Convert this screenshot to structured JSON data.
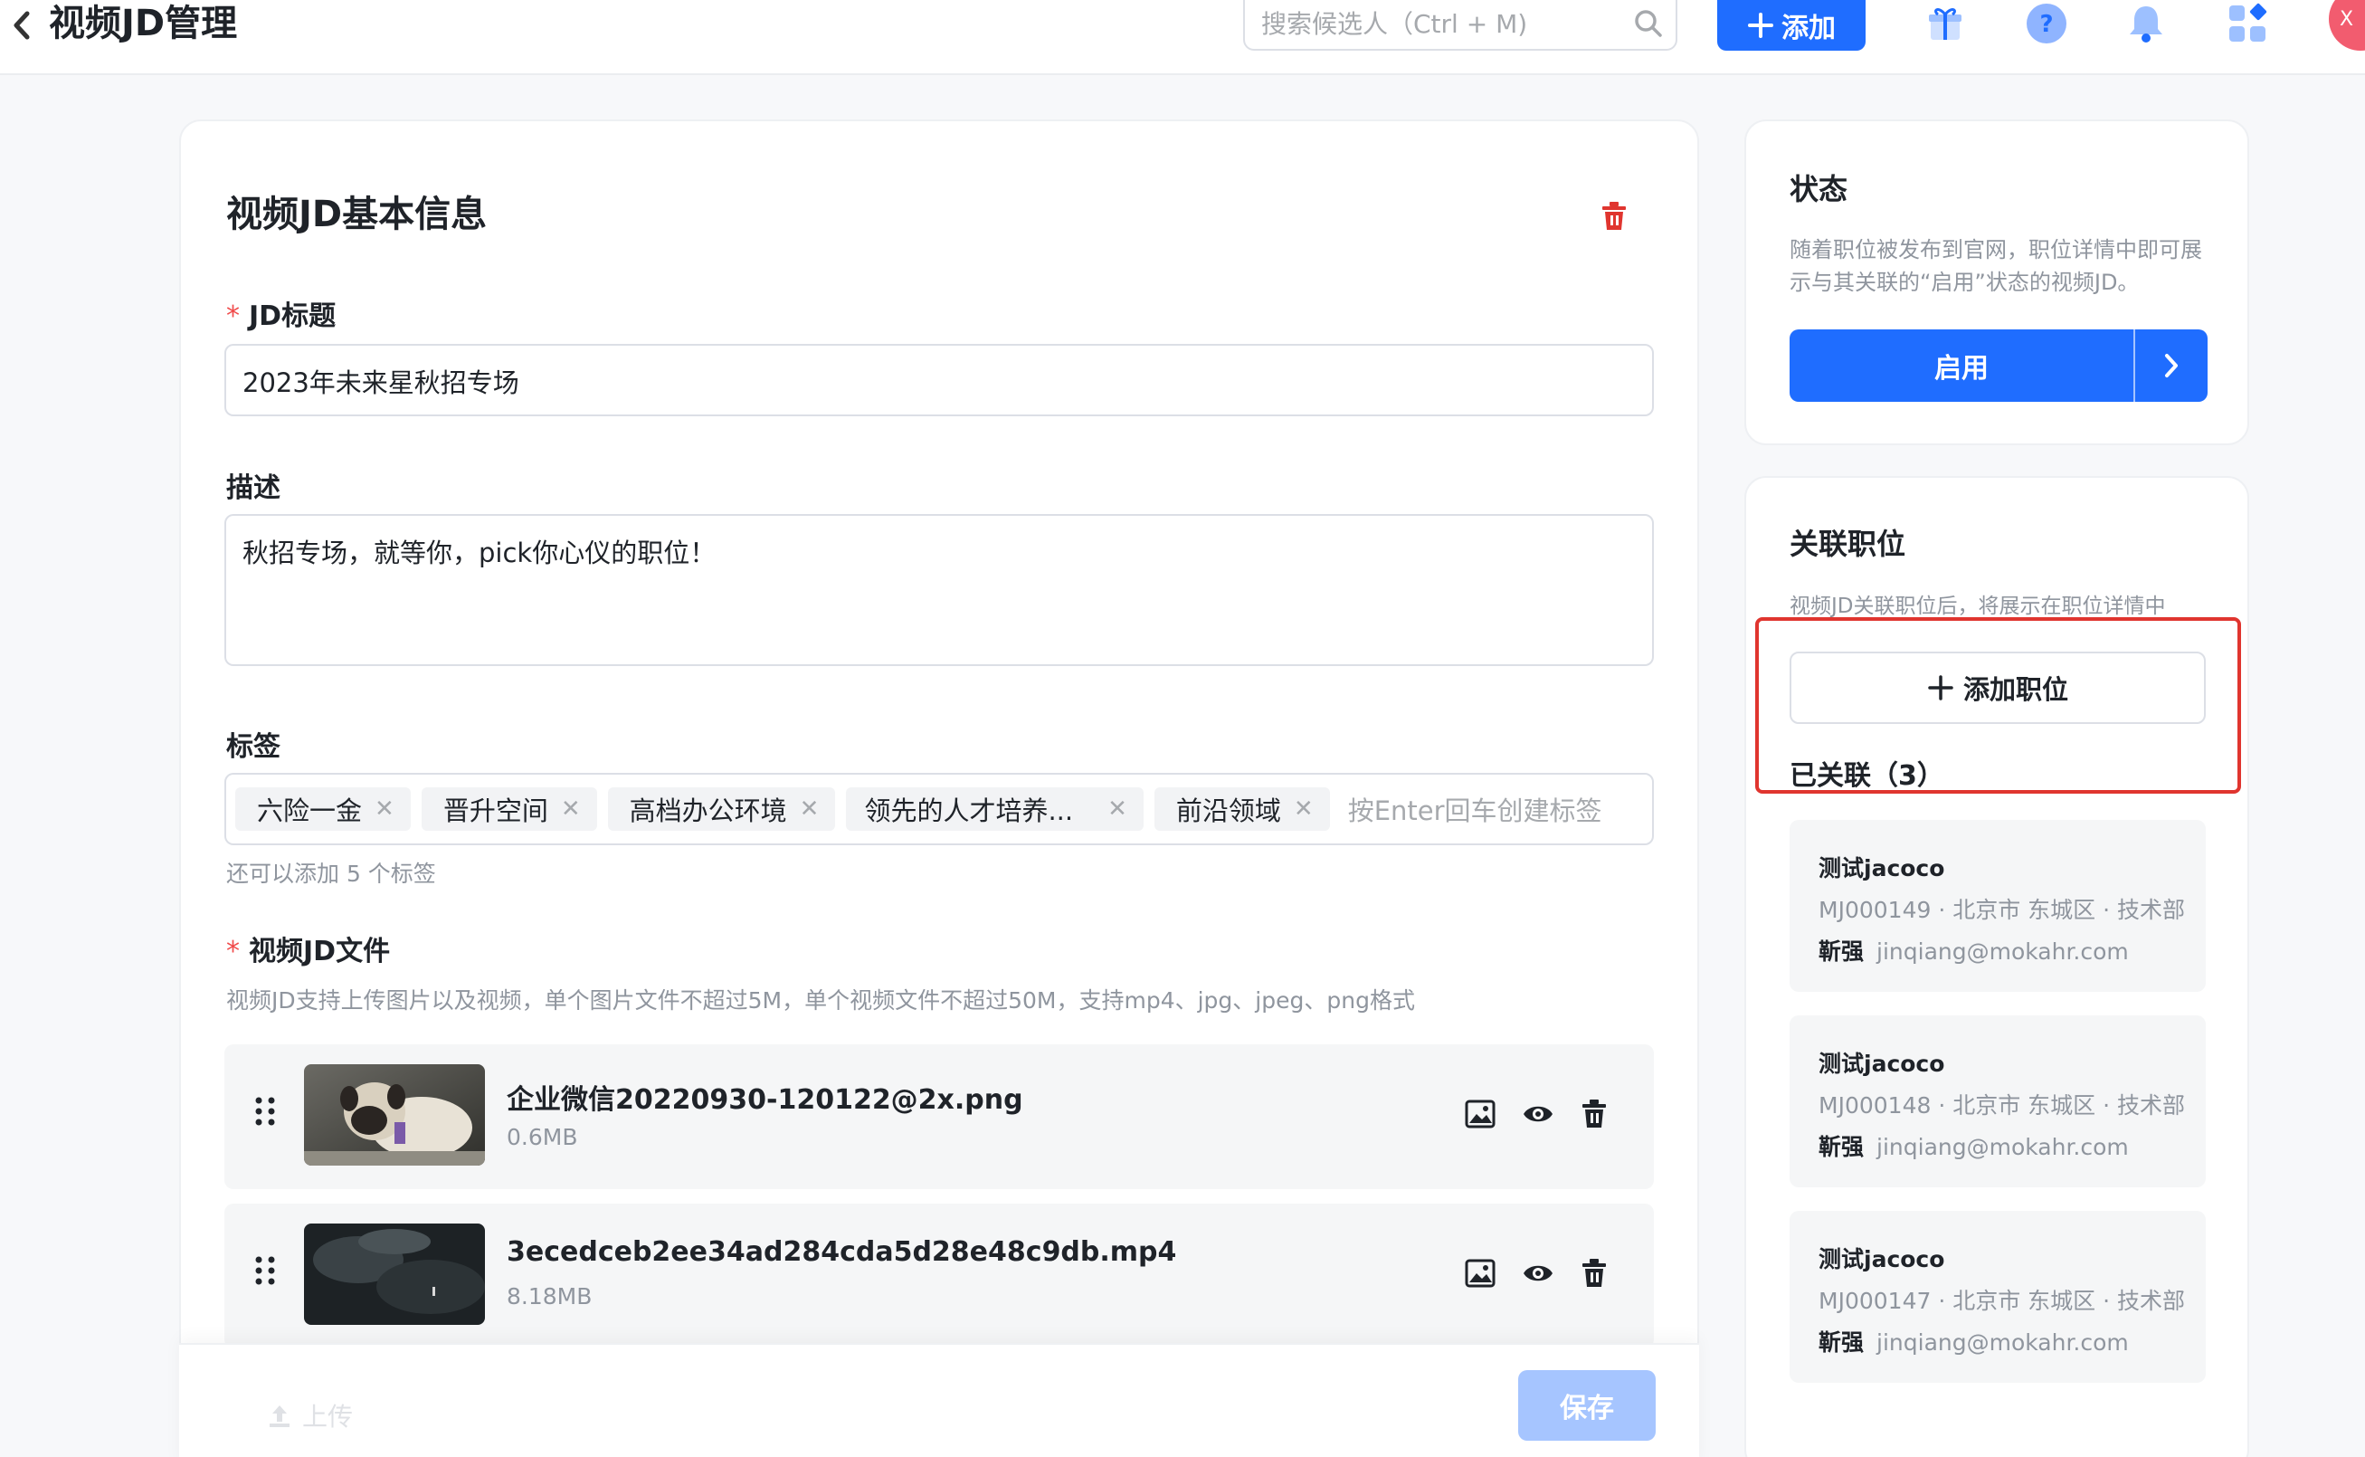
{
  "header": {
    "title": "视频JD管理",
    "search_placeholder": "搜索候选人（Ctrl + M)",
    "add_label": "添加",
    "avatar_text": "X"
  },
  "basic": {
    "title": "视频JD基本信息",
    "jd_title_label": "JD标题",
    "jd_title_value": "2023年未来星秋招专场",
    "desc_label": "描述",
    "desc_value": "秋招专场，就等你，pick你心仪的职位！",
    "tags_label": "标签",
    "tags": [
      "六险一金",
      "晋升空间",
      "高档办公环境",
      "领先的人才培养...",
      "前沿领域"
    ],
    "tag_placeholder": "按Enter回车创建标签",
    "tag_hint": "还可以添加 5 个标签",
    "files_label": "视频JD文件",
    "files_hint": "视频JD支持上传图片以及视频，单个图片文件不超过5M，单个视频文件不超过50M，支持mp4、jpg、jpeg、png格式",
    "files": [
      {
        "name": "企业微信20220930-120122@2x.png",
        "size": "0.6MB"
      },
      {
        "name": "3ecedceb2ee34ad284cda5d28e48c9db.mp4",
        "size": "8.18MB"
      }
    ]
  },
  "footer": {
    "upload_label": "上传",
    "save_label": "保存"
  },
  "status": {
    "title": "状态",
    "desc": "随着职位被发布到官网，职位详情中即可展示与其关联的“启用”状态的视频JD。",
    "button_label": "启用"
  },
  "linked": {
    "title": "关联职位",
    "desc": "视频JD关联职位后，将展示在职位详情中",
    "add_label": "添加职位",
    "count_label": "已关联（3）",
    "positions": [
      {
        "name": "测试jacoco",
        "meta": "MJ000149 · 北京市 东城区 · 技术部",
        "owner": "靳强",
        "email": "jinqiang@mokahr.com"
      },
      {
        "name": "测试jacoco",
        "meta": "MJ000148 · 北京市 东城区 · 技术部",
        "owner": "靳强",
        "email": "jinqiang@mokahr.com"
      },
      {
        "name": "测试jacoco",
        "meta": "MJ000147 · 北京市 东城区 · 技术部",
        "owner": "靳强",
        "email": "jinqiang@mokahr.com"
      }
    ]
  },
  "colors": {
    "primary": "#1f6dff",
    "danger": "#e0352f",
    "disabled_primary": "#a6c5ff"
  },
  "icons": [
    "back-chevron-icon",
    "search-icon",
    "plus-icon",
    "gift-icon",
    "help-icon",
    "bell-icon",
    "apps-icon",
    "trash-icon",
    "drag-handle-icon",
    "image-icon",
    "eye-icon",
    "upload-icon",
    "chevron-right-icon"
  ]
}
